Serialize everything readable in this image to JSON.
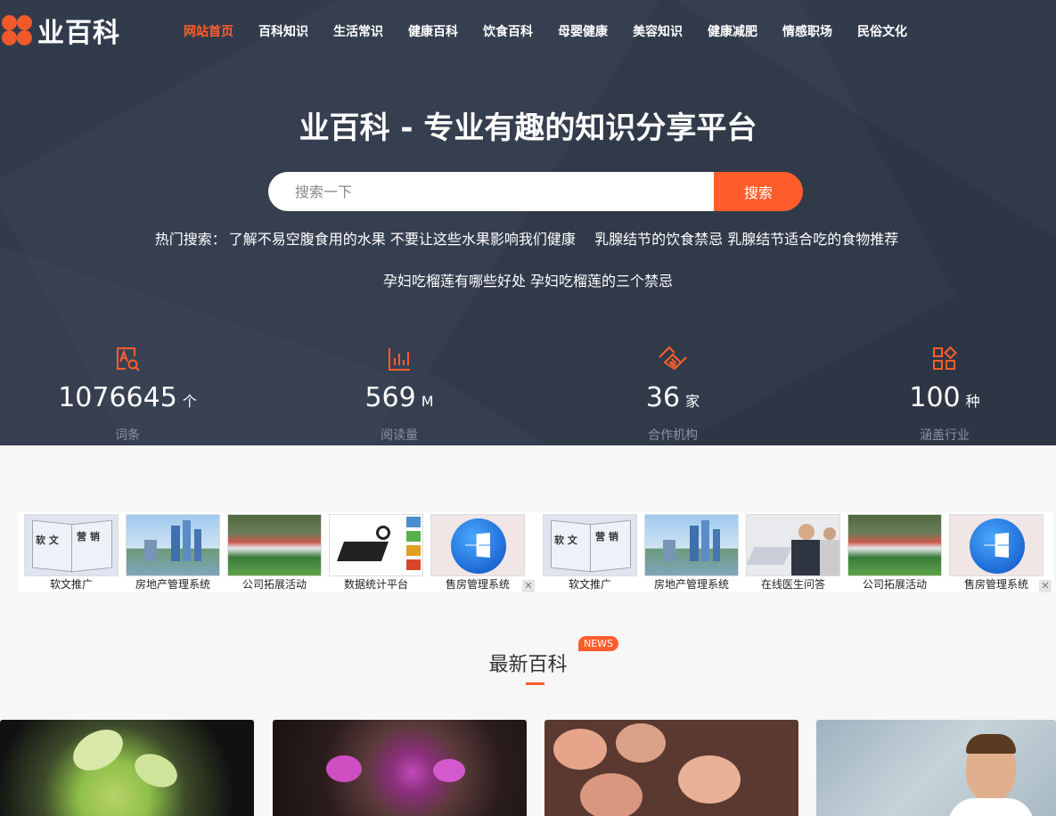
{
  "brand": {
    "logo_text": "业百科",
    "accent": "#ff5e2c",
    "hero_bg": "#323b4c"
  },
  "nav": [
    {
      "label": "网站首页",
      "active": true
    },
    {
      "label": "百科知识"
    },
    {
      "label": "生活常识"
    },
    {
      "label": "健康百科"
    },
    {
      "label": "饮食百科"
    },
    {
      "label": "母婴健康"
    },
    {
      "label": "美容知识"
    },
    {
      "label": "健康减肥"
    },
    {
      "label": "情感职场"
    },
    {
      "label": "民俗文化"
    }
  ],
  "hero": {
    "title": "业百科 - 专业有趣的知识分享平台",
    "search_placeholder": "搜索一下",
    "search_button": "搜索",
    "hot_label": "热门搜索：",
    "hot_links": [
      "了解不易空腹食用的水果 不要让这些水果影响我们健康",
      "乳腺结节的饮食禁忌 乳腺结节适合吃的食物推荐",
      "孕妇吃榴莲有哪些好处 孕妇吃榴莲的三个禁忌"
    ]
  },
  "stats": [
    {
      "icon": "search-document-icon",
      "value": "1076645",
      "unit": "个",
      "label": "词条"
    },
    {
      "icon": "bar-chart-icon",
      "value": "569",
      "unit": "M",
      "label": "阅读量"
    },
    {
      "icon": "handshake-icon",
      "value": "36",
      "unit": "家",
      "label": "合作机构"
    },
    {
      "icon": "categories-icon",
      "value": "100",
      "unit": "种",
      "label": "涵盖行业"
    }
  ],
  "ads": {
    "group1": [
      "软文推广",
      "房地产管理系统",
      "公司拓展活动",
      "数据统计平台",
      "售房管理系统"
    ],
    "group2": [
      "软文推广",
      "房地产管理系统",
      "在线医生问答",
      "公司拓展活动",
      "售房管理系统"
    ],
    "book_text_left": "软 文",
    "book_text_right": "营 销"
  },
  "latest": {
    "title": "最新百科",
    "badge": "NEWS"
  }
}
